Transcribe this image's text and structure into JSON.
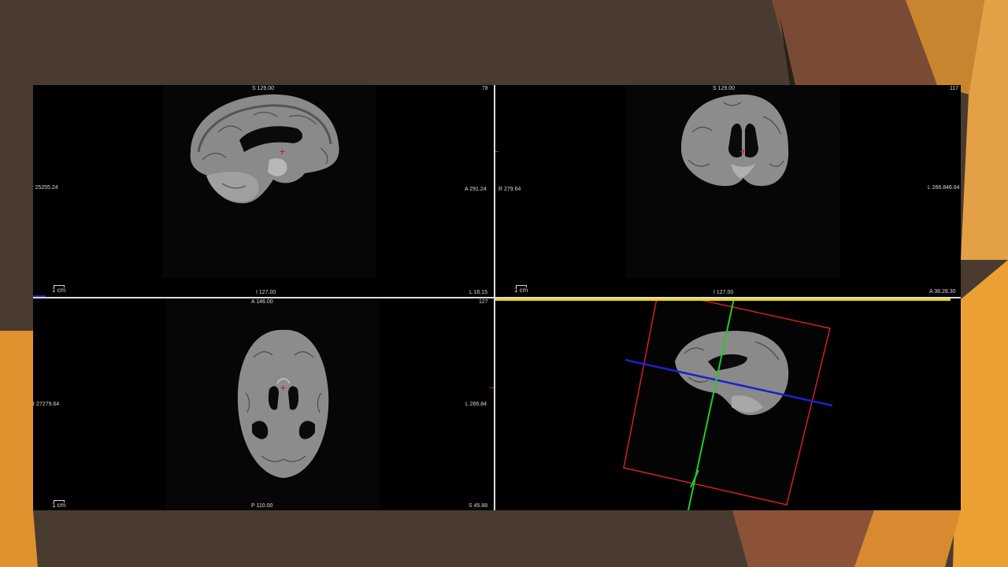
{
  "slide": {
    "background_color": "#4a3b30",
    "accent_colors": [
      "#e8a030",
      "#c97a32",
      "#8a5238"
    ]
  },
  "viewer": {
    "scale_label": "1 cm",
    "sagittal": {
      "top": "S 129.00",
      "top_right": "78",
      "left": "P 25255.24",
      "right": "A 291.24",
      "bottom": "I 127.00",
      "bottom_right": "L 16.15"
    },
    "coronal": {
      "top": "S 129.00",
      "top_right": "117",
      "left": "R 279.64",
      "right": "L 266.846.84",
      "bottom": "I 127.00",
      "bottom_right": "A 38.28.30"
    },
    "axial": {
      "top": "A 146.00",
      "top_right": "127",
      "left": "R 27279.64",
      "right": "L 266.84",
      "bottom": "P 110.00",
      "bottom_right": "S 45.88"
    },
    "view3d": {
      "plane_colors": {
        "axial": "#1a22cc",
        "sagittal": "#22cc22",
        "coronal": "#d42020",
        "crosshair_h": "#e8d020"
      }
    }
  }
}
